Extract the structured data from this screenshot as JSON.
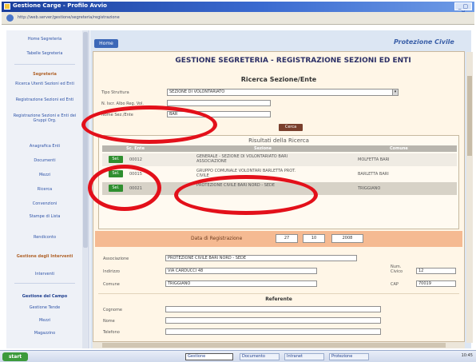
{
  "window": {
    "title": "Gestione Carge - Profilo Avvio",
    "url": "http://web.server/gestione/segreteria/registrazione"
  },
  "sidebar": {
    "items": [
      {
        "label": "Home Segreteria",
        "style": "plain"
      },
      {
        "label": "Tabelle Segreteria",
        "style": "plain"
      },
      {
        "label": "Segreteria",
        "style": "header"
      },
      {
        "label": "Ricerca Utenti Sezioni ed Enti",
        "style": "plain"
      },
      {
        "label": "Registrazione Sezioni ed Enti",
        "style": "plain"
      },
      {
        "label": "Registrazione Sezioni e Enti dei Gruppi Org.",
        "style": "plain"
      },
      {
        "label": "Anagrafica Enti",
        "style": "plain"
      },
      {
        "label": "Documenti",
        "style": "plain"
      },
      {
        "label": "Mezzi",
        "style": "plain"
      },
      {
        "label": "Ricerca",
        "style": "plain"
      },
      {
        "label": "Convenzioni",
        "style": "plain"
      },
      {
        "label": "Stampe di Lista",
        "style": "plain"
      },
      {
        "label": "Rendiconto",
        "style": "plain"
      },
      {
        "label": "Gestione degli Interventi",
        "style": "header"
      },
      {
        "label": "Interventi",
        "style": "plain"
      },
      {
        "label": "Gestione del Campo",
        "style": "blue"
      },
      {
        "label": "Gestione Tende",
        "style": "plain"
      },
      {
        "label": "Mezzi",
        "style": "plain"
      },
      {
        "label": "Magazzino",
        "style": "plain"
      }
    ]
  },
  "main": {
    "back_label": "Home",
    "logo_text": "Protezione Civile",
    "page_title": "GESTIONE SEGRETERIA - REGISTRAZIONE SEZIONI ED ENTI",
    "search": {
      "section_title": "Ricerca Sezione/Ente",
      "fields": [
        {
          "label": "Tipo Struttura",
          "value": "SEZIONE DI VOLONTARIATO",
          "kind": "select"
        },
        {
          "label": "N. Iscr. Albo Reg. Vol.",
          "value": "",
          "kind": "input"
        },
        {
          "label": "Nome Sez./Ente",
          "value": "BAR",
          "kind": "input"
        }
      ],
      "button_label": "Cerca"
    },
    "results": {
      "title": "Risultati della Ricerca",
      "columns": [
        "Sc. Ente",
        "Sezione",
        "Comune"
      ],
      "select_label": "Sel.",
      "rows": [
        {
          "code": "00012",
          "name": "GENERALE - SEZIONE DI VOLONTARIATO BARI ASSOCIAZIONE",
          "city": "MOLFETTA BARI"
        },
        {
          "code": "00015",
          "name": "GRUPPO COMUNALE VOLONTARI BARLETTA PROT. CIVILE",
          "city": "BARLETTA BARI"
        },
        {
          "code": "00021",
          "name": "PROTEZIONE CIVILE BARI NORD - SEDE",
          "city": "TRIGGIANO"
        }
      ]
    },
    "datebar": {
      "label": "Data di Registrazione",
      "day": "27",
      "month": "10",
      "year": "2008"
    },
    "details": {
      "fields_left": [
        {
          "label": "Associazione",
          "value": "PROTEZIONE CIVILE BARI NORD - SEDE"
        },
        {
          "label": "Indirizzo",
          "value": "VIA CARDUCCI 48"
        },
        {
          "label": "Comune",
          "value": "TRIGGIANO"
        }
      ],
      "fields_right": [
        {
          "label": "Num. Civico",
          "value": "12"
        },
        {
          "label": "CAP",
          "value": "70019"
        }
      ],
      "referente_title": "Referente",
      "referente_fields": [
        "Cognome",
        "Nome",
        "Telefono"
      ]
    }
  },
  "taskbar": {
    "start_label": "start",
    "items": [
      "Gestione",
      "Documento",
      "Intranet",
      "Protezione"
    ],
    "clock": "10:45"
  },
  "colors": {
    "annotation": "#e3101a",
    "title_text": "#2b2f66",
    "content_bg": "#fff6e7",
    "datebar_bg": "#f5ba92",
    "select_button": "#2f8f2f"
  }
}
